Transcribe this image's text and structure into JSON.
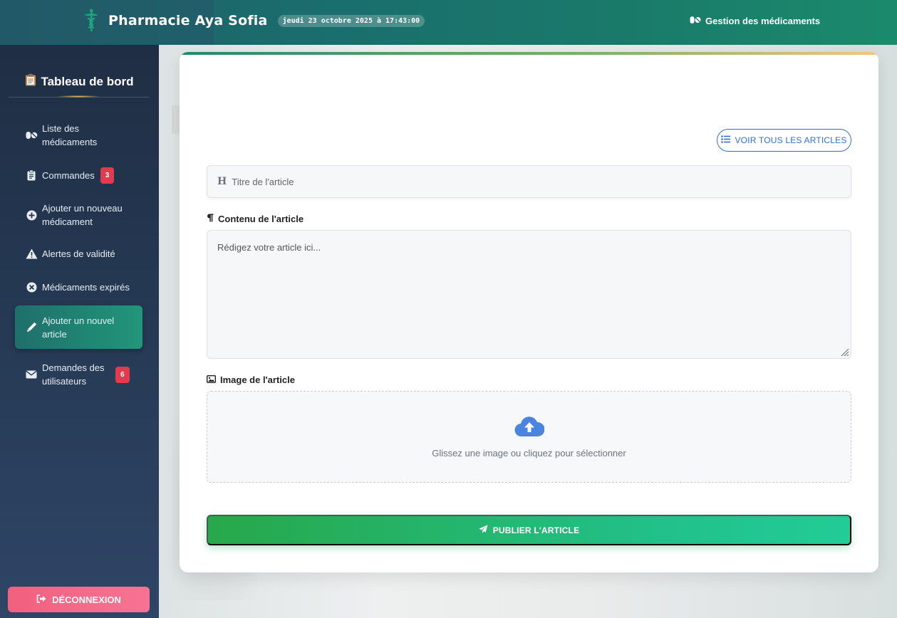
{
  "header": {
    "brand": "Pharmacie Aya Sofia",
    "datetime": "jeudi 23 octobre 2025 à 17:43:00",
    "nav_link": "Gestion des médicaments"
  },
  "sidebar": {
    "title": "Tableau de bord",
    "items": [
      {
        "label": "Liste des médicaments",
        "icon": "pills-icon"
      },
      {
        "label": "Commandes",
        "icon": "clipboard-icon",
        "badge": "3"
      },
      {
        "label": "Ajouter un nouveau médicament",
        "icon": "plus-circle-icon"
      },
      {
        "label": "Alertes de validité",
        "icon": "warning-icon"
      },
      {
        "label": "Médicaments expirés",
        "icon": "x-circle-icon"
      },
      {
        "label": "Ajouter un nouvel article",
        "icon": "pen-icon",
        "active": true
      },
      {
        "label": "Demandes des utilisateurs",
        "icon": "envelope-icon",
        "badge": "6"
      }
    ],
    "logout": "DÉCONNEXION"
  },
  "form": {
    "view_all": "VOIR TOUS LES ARTICLES",
    "title_placeholder": "Titre de l'article",
    "content_label": "Contenu de l'article",
    "content_placeholder": "Rédigez votre article ici...",
    "image_label": "Image de l'article",
    "dropzone_text": "Glissez une image ou cliquez pour sélectionner",
    "publish": "PUBLIER L'ARTICLE"
  },
  "colors": {
    "accent_green": "#22967a",
    "badge_red": "#e23b4e",
    "link_blue": "#2f6fd6",
    "logout_pink": "#f2607e"
  }
}
